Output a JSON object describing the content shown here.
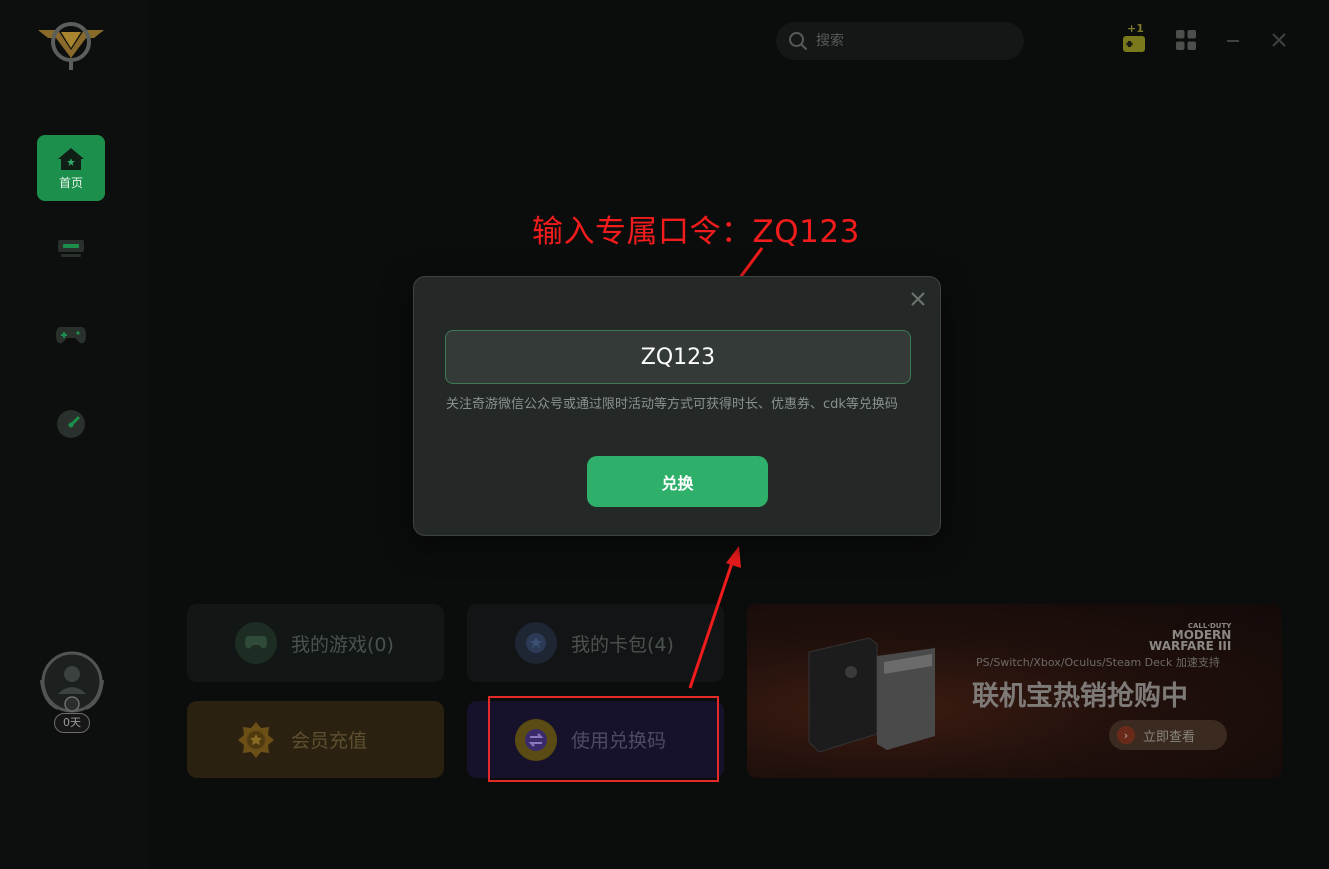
{
  "sidebar": {
    "home_label": "首页",
    "user_days": "0天"
  },
  "header": {
    "search_placeholder": "搜索",
    "gift_badge": "+1"
  },
  "cards": {
    "my_games": "我的游戏(0)",
    "my_cards": "我的卡包(4)",
    "vip_recharge": "会员充值",
    "use_code": "使用兑换码"
  },
  "banner": {
    "brand_line1": "CALL·DUTY",
    "brand_line2": "MODERN",
    "brand_line3": "WARFARE III",
    "subtitle": "PS/Switch/Xbox/Oculus/Steam Deck 加速支持",
    "title": "联机宝热销抢购中",
    "button_label": "立即查看"
  },
  "annotation": {
    "text": "输入专属口令：ZQ123"
  },
  "modal": {
    "code_value": "ZQ123",
    "hint": "关注奇游微信公众号或通过限时活动等方式可获得时长、优惠券、cdk等兑换码",
    "redeem_label": "兑换"
  },
  "colors": {
    "accent_green": "#2eb06a",
    "annotation_red": "#f21c1c",
    "modal_bg": "#242927"
  }
}
